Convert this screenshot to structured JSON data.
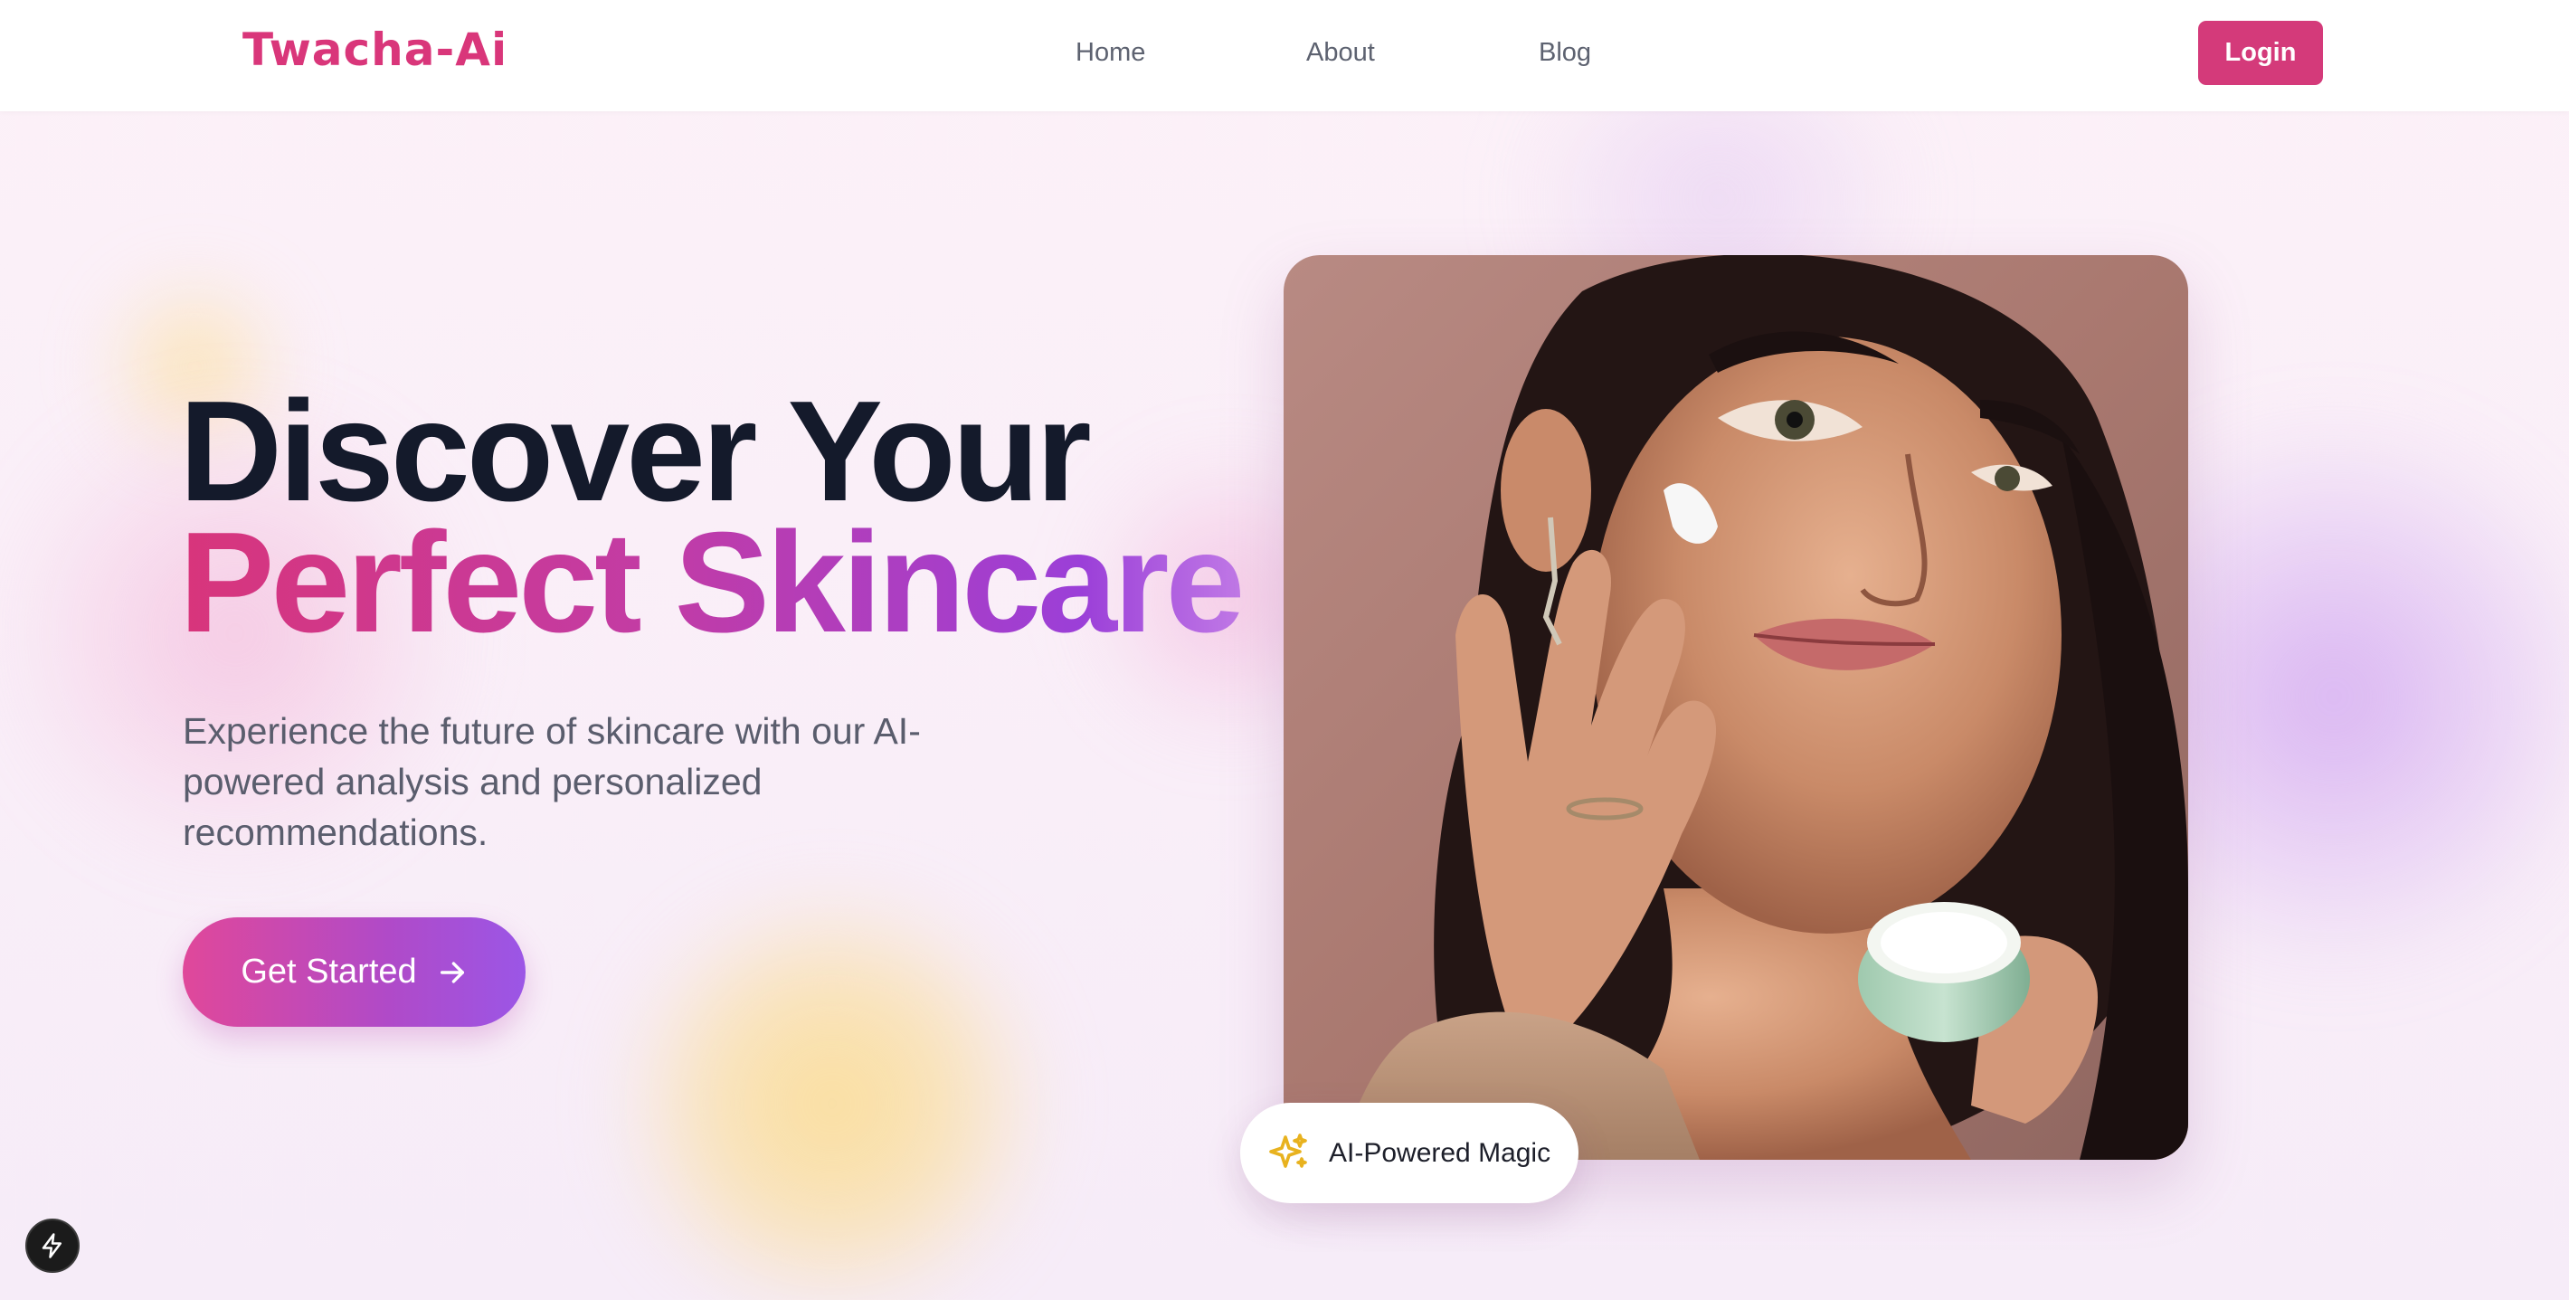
{
  "brand": {
    "name": "Twacha-Ai",
    "color": "#d9367a"
  },
  "nav": {
    "links": [
      {
        "label": "Home"
      },
      {
        "label": "About"
      },
      {
        "label": "Blog"
      }
    ],
    "login_label": "Login"
  },
  "hero": {
    "title_line1": "Discover Your",
    "title_line2": "Perfect Skincare",
    "description": "Experience the future of skincare with our AI-powered analysis and personalized recommendations.",
    "cta_label": "Get Started",
    "cta_icon": "arrow-right-icon",
    "image_alt": "woman-applying-skin-cream-photo",
    "badge_label": "AI-Powered Magic",
    "badge_icon": "sparkles-icon"
  },
  "floating": {
    "icon": "bolt-icon"
  },
  "colors": {
    "accent": "#d43a7a",
    "gradient_start": "#d8357b",
    "gradient_end": "#9b3fd8",
    "badge_icon": "#e8b21f"
  }
}
